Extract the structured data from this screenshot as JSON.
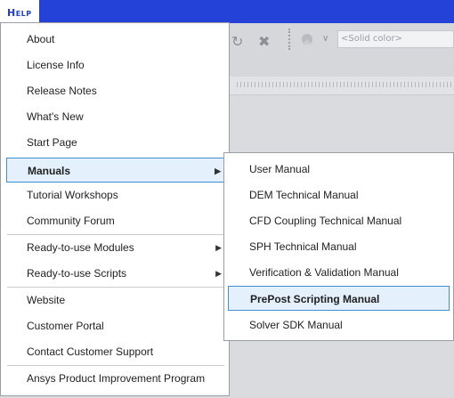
{
  "menubar": {
    "help_label": "Help"
  },
  "toolbar": {
    "color_placeholder": "<Solid color>"
  },
  "help_menu": {
    "items": [
      {
        "label": "About"
      },
      {
        "label": "License Info"
      },
      {
        "label": "Release Notes"
      },
      {
        "label": "What's New"
      },
      {
        "label": "Start Page"
      },
      {
        "label": "Manuals",
        "selected": true,
        "has_submenu": true
      },
      {
        "label": "Tutorial Workshops"
      },
      {
        "label": "Community Forum"
      },
      {
        "label": "Ready-to-use Modules",
        "has_submenu": true
      },
      {
        "label": "Ready-to-use Scripts",
        "has_submenu": true
      },
      {
        "label": "Website"
      },
      {
        "label": "Customer Portal"
      },
      {
        "label": "Contact Customer Support"
      },
      {
        "label": "Ansys Product Improvement Program"
      }
    ]
  },
  "manuals_submenu": {
    "items": [
      {
        "label": "User Manual"
      },
      {
        "label": "DEM Technical Manual"
      },
      {
        "label": "CFD Coupling Technical Manual"
      },
      {
        "label": "SPH Technical Manual"
      },
      {
        "label": "Verification & Validation Manual"
      },
      {
        "label": "PrePost Scripting Manual",
        "selected": true
      },
      {
        "label": "Solver SDK Manual"
      }
    ]
  },
  "colors": {
    "menubar_bg": "#2442d8",
    "selection_bg": "#e4f0fb",
    "selection_border": "#3f8fd2"
  }
}
